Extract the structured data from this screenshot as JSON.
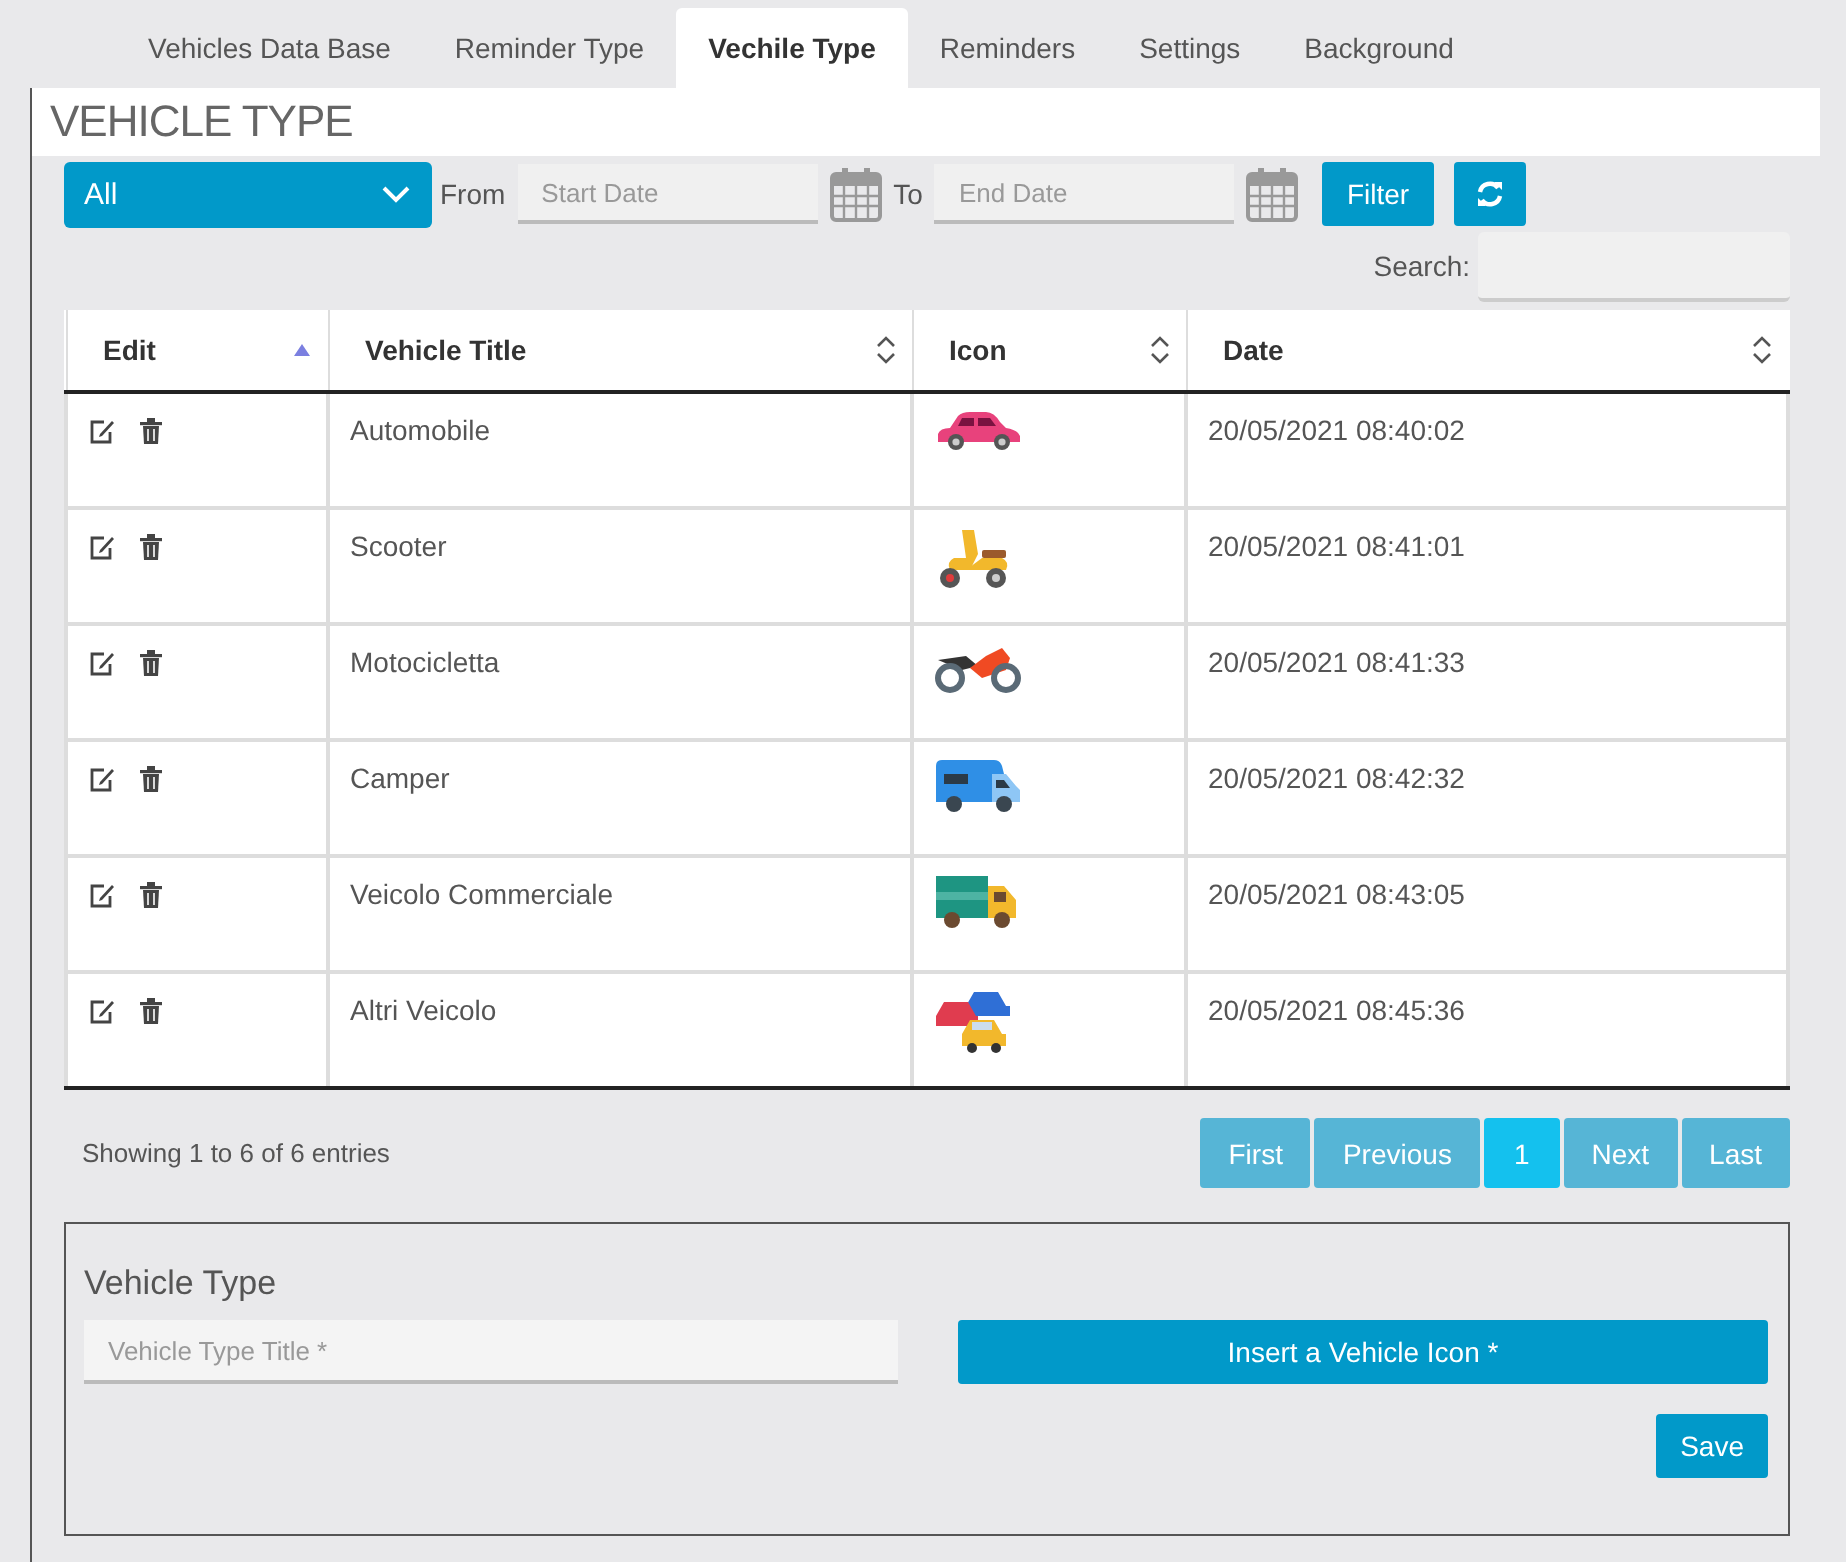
{
  "tabs": [
    {
      "label": "Vehicles Data Base",
      "selected": false
    },
    {
      "label": "Reminder Type",
      "selected": false
    },
    {
      "label": "Vechile Type",
      "selected": true
    },
    {
      "label": "Reminders",
      "selected": false
    },
    {
      "label": "Settings",
      "selected": false
    },
    {
      "label": "Background",
      "selected": false
    }
  ],
  "page_title": "VEHICLE TYPE",
  "filter": {
    "select_value": "All",
    "from_label": "From",
    "start_placeholder": "Start Date",
    "to_label": "To",
    "end_placeholder": "End Date",
    "filter_button": "Filter"
  },
  "search": {
    "label": "Search:"
  },
  "table": {
    "columns": [
      {
        "label": "Edit",
        "sorted": true
      },
      {
        "label": "Vehicle Title",
        "sorted": false
      },
      {
        "label": "Icon",
        "sorted": false
      },
      {
        "label": "Date",
        "sorted": false
      }
    ],
    "rows": [
      {
        "title": "Automobile",
        "kind": "car",
        "date": "20/05/2021 08:40:02"
      },
      {
        "title": "Scooter",
        "kind": "scooter",
        "date": "20/05/2021 08:41:01"
      },
      {
        "title": "Motocicletta",
        "kind": "motorcycle",
        "date": "20/05/2021 08:41:33"
      },
      {
        "title": "Camper",
        "kind": "camper",
        "date": "20/05/2021 08:42:32"
      },
      {
        "title": "Veicolo Commerciale",
        "kind": "truck",
        "date": "20/05/2021 08:43:05"
      },
      {
        "title": "Altri Veicolo",
        "kind": "cars",
        "date": "20/05/2021 08:45:36"
      }
    ]
  },
  "info": "Showing 1 to 6 of 6 entries",
  "pagination": [
    {
      "label": "First",
      "selected": false
    },
    {
      "label": "Previous",
      "selected": false
    },
    {
      "label": "1",
      "selected": true
    },
    {
      "label": "Next",
      "selected": false
    },
    {
      "label": "Last",
      "selected": false
    }
  ],
  "form": {
    "title": "Vehicle Type",
    "title_placeholder": "Vehicle Type Title *",
    "icon_button": "Insert a Vehicle Icon *",
    "save_button": "Save"
  }
}
